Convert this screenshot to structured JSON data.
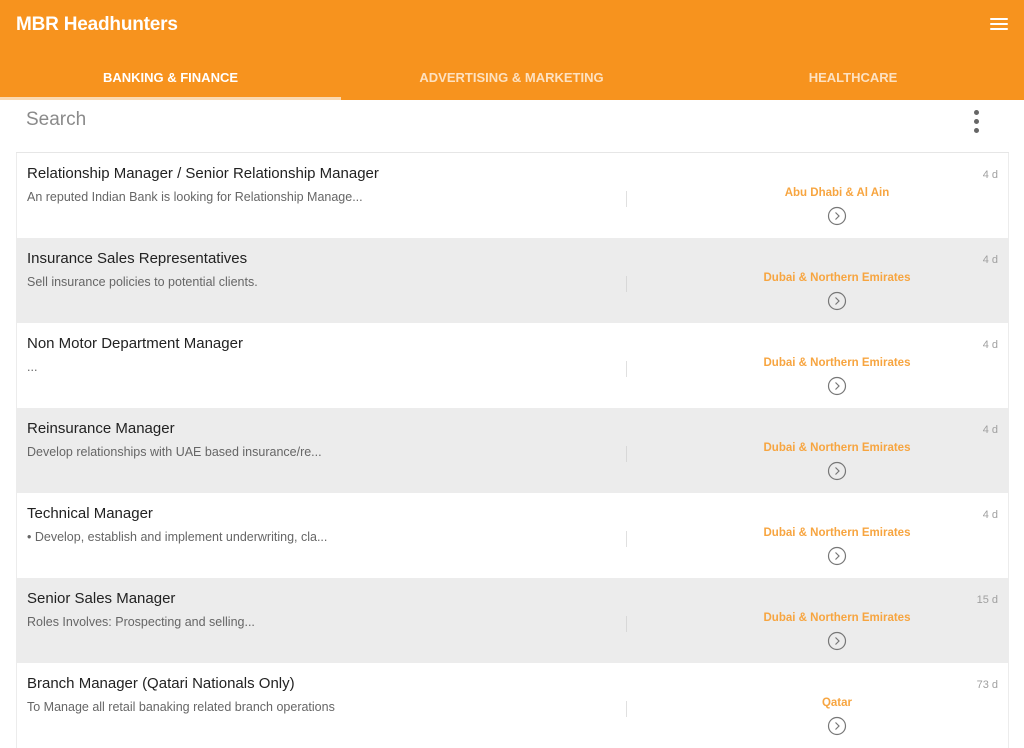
{
  "app": {
    "title": "MBR Headhunters",
    "accent": "#f7931e",
    "location_color": "#f7a540"
  },
  "tabs": [
    {
      "label": "BANKING & FINANCE",
      "active": true
    },
    {
      "label": "ADVERTISING & MARKETING",
      "active": false
    },
    {
      "label": "HEALTHCARE",
      "active": false
    }
  ],
  "search": {
    "placeholder": "Search",
    "value": ""
  },
  "icons": {
    "menu": "hamburger-menu-icon",
    "more": "more-vertical-icon",
    "arrow": "chevron-right-circle-icon"
  },
  "jobs": [
    {
      "title": "Relationship Manager / Senior Relationship Manager",
      "desc": "An reputed Indian Bank is looking for Relationship Manage...",
      "location": "Abu Dhabi & Al Ain",
      "age": "4 d"
    },
    {
      "title": "Insurance Sales Representatives",
      "desc": "Sell insurance policies to potential clients.",
      "location": "Dubai & Northern Emirates",
      "age": "4 d"
    },
    {
      "title": "Non Motor Department Manager",
      "desc": "...",
      "location": "Dubai & Northern Emirates",
      "age": "4 d"
    },
    {
      "title": "Reinsurance Manager",
      "desc": "Develop relationships with UAE based insurance/re...",
      "location": "Dubai & Northern Emirates",
      "age": "4 d"
    },
    {
      "title": "Technical Manager",
      "desc": "• Develop, establish and implement underwriting, cla...",
      "location": "Dubai & Northern Emirates",
      "age": "4 d"
    },
    {
      "title": "Senior Sales Manager",
      "desc": "Roles Involves: Prospecting and selling...",
      "location": "Dubai & Northern Emirates",
      "age": "15 d"
    },
    {
      "title": "Branch Manager (Qatari Nationals Only)",
      "desc": "To Manage all retail banaking related branch operations",
      "location": "Qatar",
      "age": "73 d"
    }
  ]
}
